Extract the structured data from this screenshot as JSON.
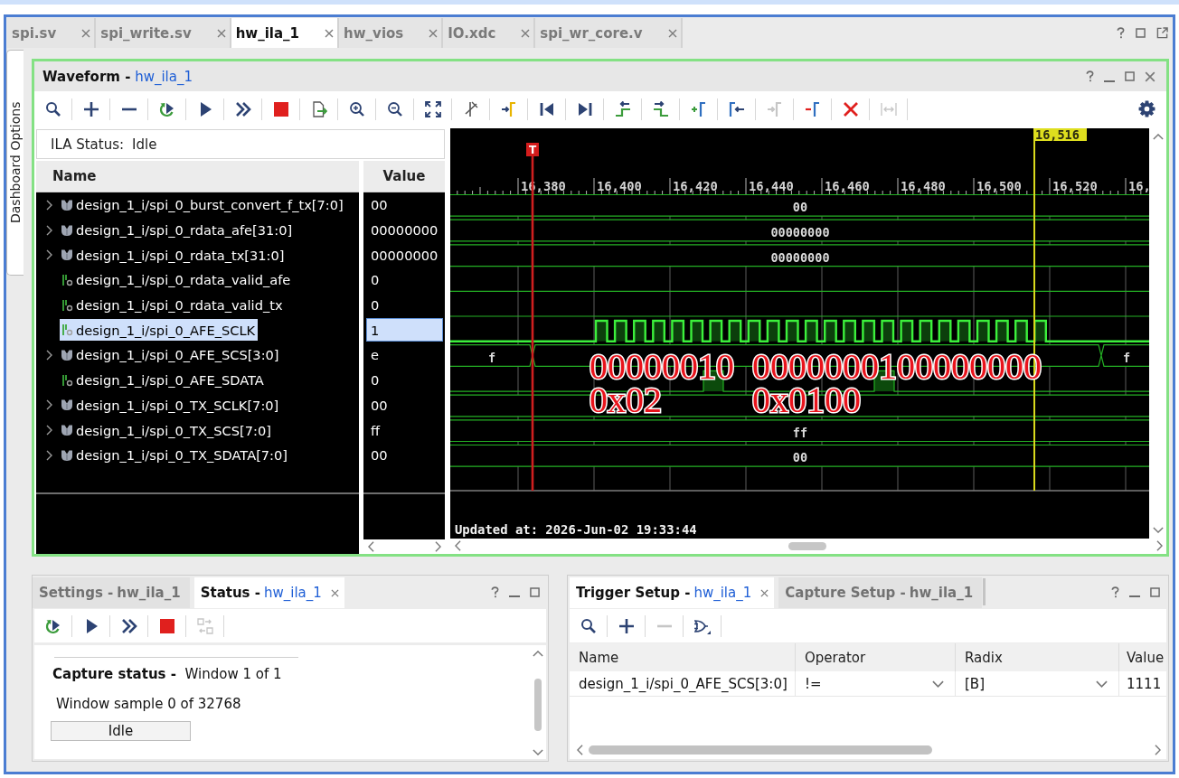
{
  "editor_tabs": [
    {
      "label": "spi.sv",
      "selected": false
    },
    {
      "label": "spi_write.sv",
      "selected": false
    },
    {
      "label": "hw_ila_1",
      "selected": true
    },
    {
      "label": "hw_vios",
      "selected": false
    },
    {
      "label": "IO.xdc",
      "selected": false
    },
    {
      "label": "spi_wr_core.v",
      "selected": false
    }
  ],
  "side_tab": "Dashboard Options",
  "waveform": {
    "title": "Waveform -",
    "target": "hw_ila_1",
    "toolbar": [
      {
        "kind": "search",
        "disabled": false
      },
      {
        "kind": "add",
        "disabled": false
      },
      {
        "kind": "remove",
        "disabled": false
      },
      {
        "kind": "run_immediate",
        "disabled": false
      },
      {
        "kind": "run",
        "disabled": false
      },
      {
        "kind": "run_all",
        "disabled": false
      },
      {
        "kind": "stop",
        "disabled": false
      },
      {
        "kind": "export",
        "disabled": false
      },
      {
        "kind": "zoom_in",
        "disabled": false
      },
      {
        "kind": "zoom_out",
        "disabled": false
      },
      {
        "kind": "zoom_fit",
        "disabled": false
      },
      {
        "kind": "cut",
        "disabled": false
      },
      {
        "kind": "goto_cursor",
        "disabled": false
      },
      {
        "kind": "goto_start",
        "disabled": false
      },
      {
        "kind": "goto_end",
        "disabled": false
      },
      {
        "kind": "swap_left",
        "disabled": false
      },
      {
        "kind": "swap_right",
        "disabled": false
      },
      {
        "kind": "add_marker",
        "disabled": false
      },
      {
        "kind": "prev_marker",
        "disabled": false
      },
      {
        "kind": "next_marker",
        "disabled": true
      },
      {
        "kind": "remove_marker",
        "disabled": false
      },
      {
        "kind": "delete_all",
        "disabled": false
      },
      {
        "kind": "measure",
        "disabled": true
      }
    ],
    "ila_status": {
      "label": "ILA Status:",
      "value": "Idle"
    },
    "columns": [
      "Name",
      "Value"
    ],
    "signals": [
      {
        "kind": "bus",
        "name": "design_1_i/spi_0_burst_convert_f_tx[7:0]",
        "value": "00",
        "selected": false,
        "trace": {
          "kind": "bus",
          "label": "00"
        }
      },
      {
        "kind": "bus",
        "name": "design_1_i/spi_0_rdata_afe[31:0]",
        "value": "00000000",
        "selected": false,
        "trace": {
          "kind": "bus",
          "label": "00000000"
        }
      },
      {
        "kind": "bus",
        "name": "design_1_i/spi_0_rdata_tx[31:0]",
        "value": "00000000",
        "selected": false,
        "trace": {
          "kind": "bus",
          "label": "00000000"
        }
      },
      {
        "kind": "bit",
        "name": "design_1_i/spi_0_rdata_valid_afe",
        "value": "0",
        "selected": false,
        "trace": {
          "kind": "low"
        }
      },
      {
        "kind": "bit",
        "name": "design_1_i/spi_0_rdata_valid_tx",
        "value": "0",
        "selected": false,
        "trace": {
          "kind": "low"
        }
      },
      {
        "kind": "bit",
        "name": "design_1_i/spi_0_AFE_SCLK",
        "value": "1",
        "selected": true,
        "trace": {
          "kind": "clock"
        }
      },
      {
        "kind": "bus",
        "name": "design_1_i/spi_0_AFE_SCS[3:0]",
        "value": "e",
        "selected": false,
        "trace": {
          "kind": "bus_split",
          "labels": [
            "f",
            "f"
          ]
        }
      },
      {
        "kind": "bit",
        "name": "design_1_i/spi_0_AFE_SDATA",
        "value": "0",
        "selected": false,
        "trace": {
          "kind": "pulses"
        }
      },
      {
        "kind": "bus",
        "name": "design_1_i/spi_0_TX_SCLK[7:0]",
        "value": "00",
        "selected": false,
        "trace": {
          "kind": "bus"
        }
      },
      {
        "kind": "bus",
        "name": "design_1_i/spi_0_TX_SCS[7:0]",
        "value": "ff",
        "selected": false,
        "trace": {
          "kind": "bus",
          "label": "ff"
        }
      },
      {
        "kind": "bus",
        "name": "design_1_i/spi_0_TX_SDATA[7:0]",
        "value": "00",
        "selected": false,
        "trace": {
          "kind": "bus",
          "label": "00"
        }
      }
    ],
    "ruler_ticks": [
      "16,380",
      "16,400",
      "16,420",
      "16,440",
      "16,460",
      "16,480",
      "16,500",
      "16,520",
      "16,"
    ],
    "trigger_label": "T",
    "cursor_label": "16,516",
    "annotations": [
      {
        "binary": "00000010",
        "hex": "0x02"
      },
      {
        "binary": "0000000100000000",
        "hex": "0x0100"
      }
    ],
    "updated": "Updated at: 2026-Jun-02 19:33:44"
  },
  "status_panel": {
    "tabs": [
      {
        "title": "Settings -",
        "target": "hw_ila_1",
        "selected": false
      },
      {
        "title": "Status -",
        "target": "hw_ila_1",
        "selected": true
      }
    ],
    "toolbar": [
      {
        "kind": "run_immediate",
        "disabled": false
      },
      {
        "kind": "run",
        "disabled": false
      },
      {
        "kind": "run_all",
        "disabled": false
      },
      {
        "kind": "stop",
        "disabled": false
      },
      {
        "kind": "transfer",
        "disabled": true
      }
    ],
    "capture_status": {
      "label": "Capture status -",
      "value": "Window 1 of 1"
    },
    "window_sample": "Window sample 0 of 32768",
    "state": "Idle"
  },
  "trigger_panel": {
    "tabs": [
      {
        "title": "Trigger Setup -",
        "target": "hw_ila_1",
        "selected": true
      },
      {
        "title": "Capture Setup -",
        "target": "hw_ila_1",
        "selected": false
      }
    ],
    "toolbar": [
      {
        "kind": "search",
        "disabled": false
      },
      {
        "kind": "add",
        "disabled": false
      },
      {
        "kind": "remove",
        "disabled": true
      },
      {
        "kind": "gate",
        "disabled": false
      }
    ],
    "columns": [
      "Name",
      "Operator",
      "Radix",
      "Value"
    ],
    "rows": [
      {
        "name": "design_1_i/spi_0_AFE_SCS[3:0]",
        "operator": "!=",
        "radix": "[B]",
        "value": "1111"
      }
    ]
  }
}
